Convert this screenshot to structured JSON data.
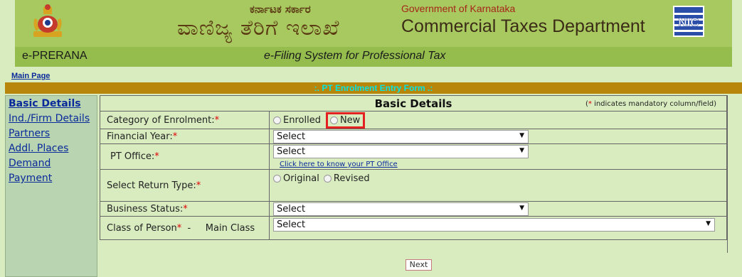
{
  "header": {
    "kannada_subtitle": "ಕರ್ನಾಟಕ ಸರ್ಕಾರ",
    "kannada_title": "ವಾಣಿಜ್ಯ ತೆರಿಗೆ ಇಲಾಖೆ",
    "gov_title": "Government of Karnataka",
    "dept_title": "Commercial Taxes Department",
    "nic_logo_text": "NIC",
    "app_name": "e-PRERANA",
    "app_desc": "e-Filing System for Professional Tax"
  },
  "nav": {
    "main_page": "Main Page"
  },
  "form": {
    "bar_title": ":. PT Enrolment Entry Form .:",
    "section_title": "Basic Details",
    "mandatory_star": "*",
    "mandatory_note": " indicates mandatory column/field)",
    "mandatory_note_open": "(",
    "rows": {
      "category": {
        "label": "Category of Enrolment:",
        "options": [
          "Enrolled",
          "New"
        ]
      },
      "financial_year": {
        "label": "Financial Year:",
        "value": "Select"
      },
      "pt_office": {
        "label": "PT Office:",
        "value": "Select",
        "link": "Click here to know your PT Office"
      },
      "return_type": {
        "label": "Select Return Type:",
        "options": [
          "Original",
          "Revised"
        ]
      },
      "business_status": {
        "label": "Business Status:",
        "value": "Select"
      },
      "class_of_person": {
        "label": "Class of Person",
        "sublabel": "-     Main Class",
        "value": "Select"
      }
    },
    "next_label": "Next"
  },
  "sidebar": {
    "items": [
      {
        "label": "Basic Details",
        "active": true
      },
      {
        "label": "Ind./Firm Details",
        "active": false
      },
      {
        "label": "Partners",
        "active": false
      },
      {
        "label": "Addl. Places",
        "active": false
      },
      {
        "label": "Demand",
        "active": false
      },
      {
        "label": "Payment",
        "active": false
      }
    ]
  },
  "colors": {
    "header_bg": "#a7c95f",
    "header_sub_bg": "#94bd4d",
    "page_bg": "#d9ecc0",
    "form_bar_bg": "#b8860b",
    "form_bar_text": "#00e6e6",
    "sidebar_bg": "#b8d4b0",
    "link": "#0a2a9b",
    "required": "#e00000",
    "highlight": "#e32121"
  }
}
